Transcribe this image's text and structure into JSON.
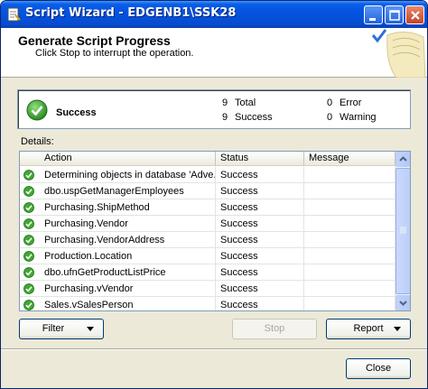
{
  "window": {
    "title": "Script Wizard - EDGENB1\\SSK28"
  },
  "header": {
    "title": "Generate Script Progress",
    "subtitle": "Click Stop to interrupt the operation."
  },
  "summary": {
    "status": "Success",
    "total_count": "9",
    "total_label": "Total",
    "success_count": "9",
    "success_label": "Success",
    "error_count": "0",
    "error_label": "Error",
    "warning_count": "0",
    "warning_label": "Warning"
  },
  "details": {
    "label": "Details:",
    "columns": [
      "Action",
      "Status",
      "Message"
    ],
    "rows": [
      {
        "action": "Determining objects in database 'Adve...",
        "status": "Success",
        "message": ""
      },
      {
        "action": "dbo.uspGetManagerEmployees",
        "status": "Success",
        "message": ""
      },
      {
        "action": "Purchasing.ShipMethod",
        "status": "Success",
        "message": ""
      },
      {
        "action": "Purchasing.Vendor",
        "status": "Success",
        "message": ""
      },
      {
        "action": "Purchasing.VendorAddress",
        "status": "Success",
        "message": ""
      },
      {
        "action": "Production.Location",
        "status": "Success",
        "message": ""
      },
      {
        "action": "dbo.ufnGetProductListPrice",
        "status": "Success",
        "message": ""
      },
      {
        "action": "Purchasing.vVendor",
        "status": "Success",
        "message": ""
      },
      {
        "action": "Sales.vSalesPerson",
        "status": "Success",
        "message": ""
      }
    ]
  },
  "buttons": {
    "filter": "Filter",
    "stop": "Stop",
    "report": "Report",
    "close": "Close"
  },
  "icons": {
    "success": "check-circle-icon",
    "title": "wizard-icon"
  },
  "colors": {
    "titlebar": "#0553e0",
    "success_green": "#3a9a2e",
    "window_bg": "#ece9d8"
  }
}
